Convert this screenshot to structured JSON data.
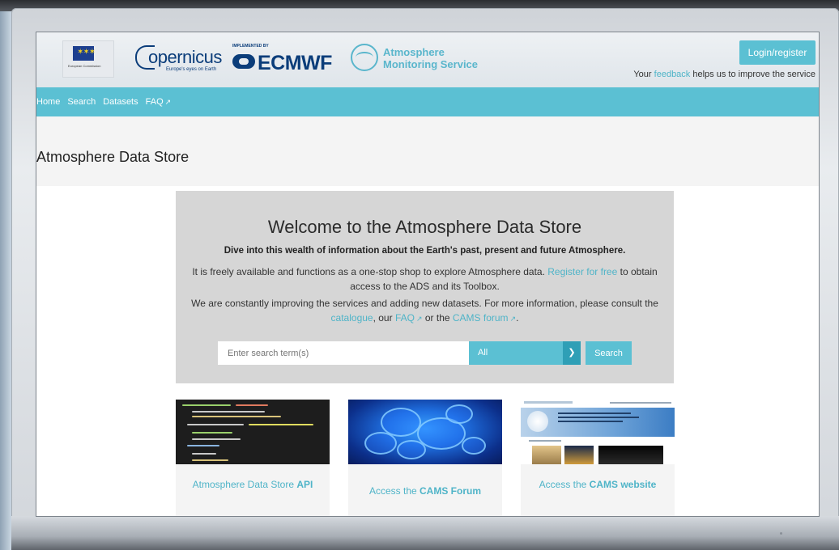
{
  "header": {
    "eu_caption": "European Commission",
    "copernicus_word": "opernicus",
    "copernicus_tagline": "Europe's eyes on Earth",
    "ecmwf_implemented_by": "IMPLEMENTED BY",
    "ecmwf_word": "ECMWF",
    "cams_line1": "Atmosphere",
    "cams_line2": "Monitoring Service",
    "login_label": "Login/register",
    "feedback_prefix": "Your ",
    "feedback_link": "feedback",
    "feedback_suffix": " helps us to improve the service"
  },
  "nav": {
    "items": [
      "Home",
      "Search",
      "Datasets",
      "FAQ"
    ],
    "external_icon": "external-link-icon"
  },
  "page": {
    "title": "Atmosphere Data Store"
  },
  "welcome": {
    "title": "Welcome to the Atmosphere Data Store",
    "subtitle": "Dive into this wealth of information about the Earth's past, present and future Atmosphere.",
    "p1_text": "It is freely available and functions as a one-stop shop to explore Atmosphere data. ",
    "p1_link": "Register for free",
    "p1_text2": " to obtain access to the ADS and its Toolbox.",
    "p2_text": "We are constantly improving the services and adding new datasets. For more information, please consult the ",
    "p2_link1": "catalogue",
    "p2_text2": ", our ",
    "p2_link2": "FAQ",
    "p2_text3": " or the ",
    "p2_link3": "CAMS forum",
    "p2_text4": "."
  },
  "search": {
    "placeholder": "Enter search term(s)",
    "select_value": "All",
    "button_label": "Search"
  },
  "cards": [
    {
      "label_pre": "Atmosphere Data Store ",
      "label_bold": "API"
    },
    {
      "label_pre": "Access the ",
      "label_bold": "CAMS Forum"
    },
    {
      "label_pre": "Access the ",
      "label_bold": "CAMS website"
    }
  ],
  "colors": {
    "accent": "#5bc0d3",
    "link": "#4fb4c8",
    "brand_blue": "#0b3d7a"
  }
}
